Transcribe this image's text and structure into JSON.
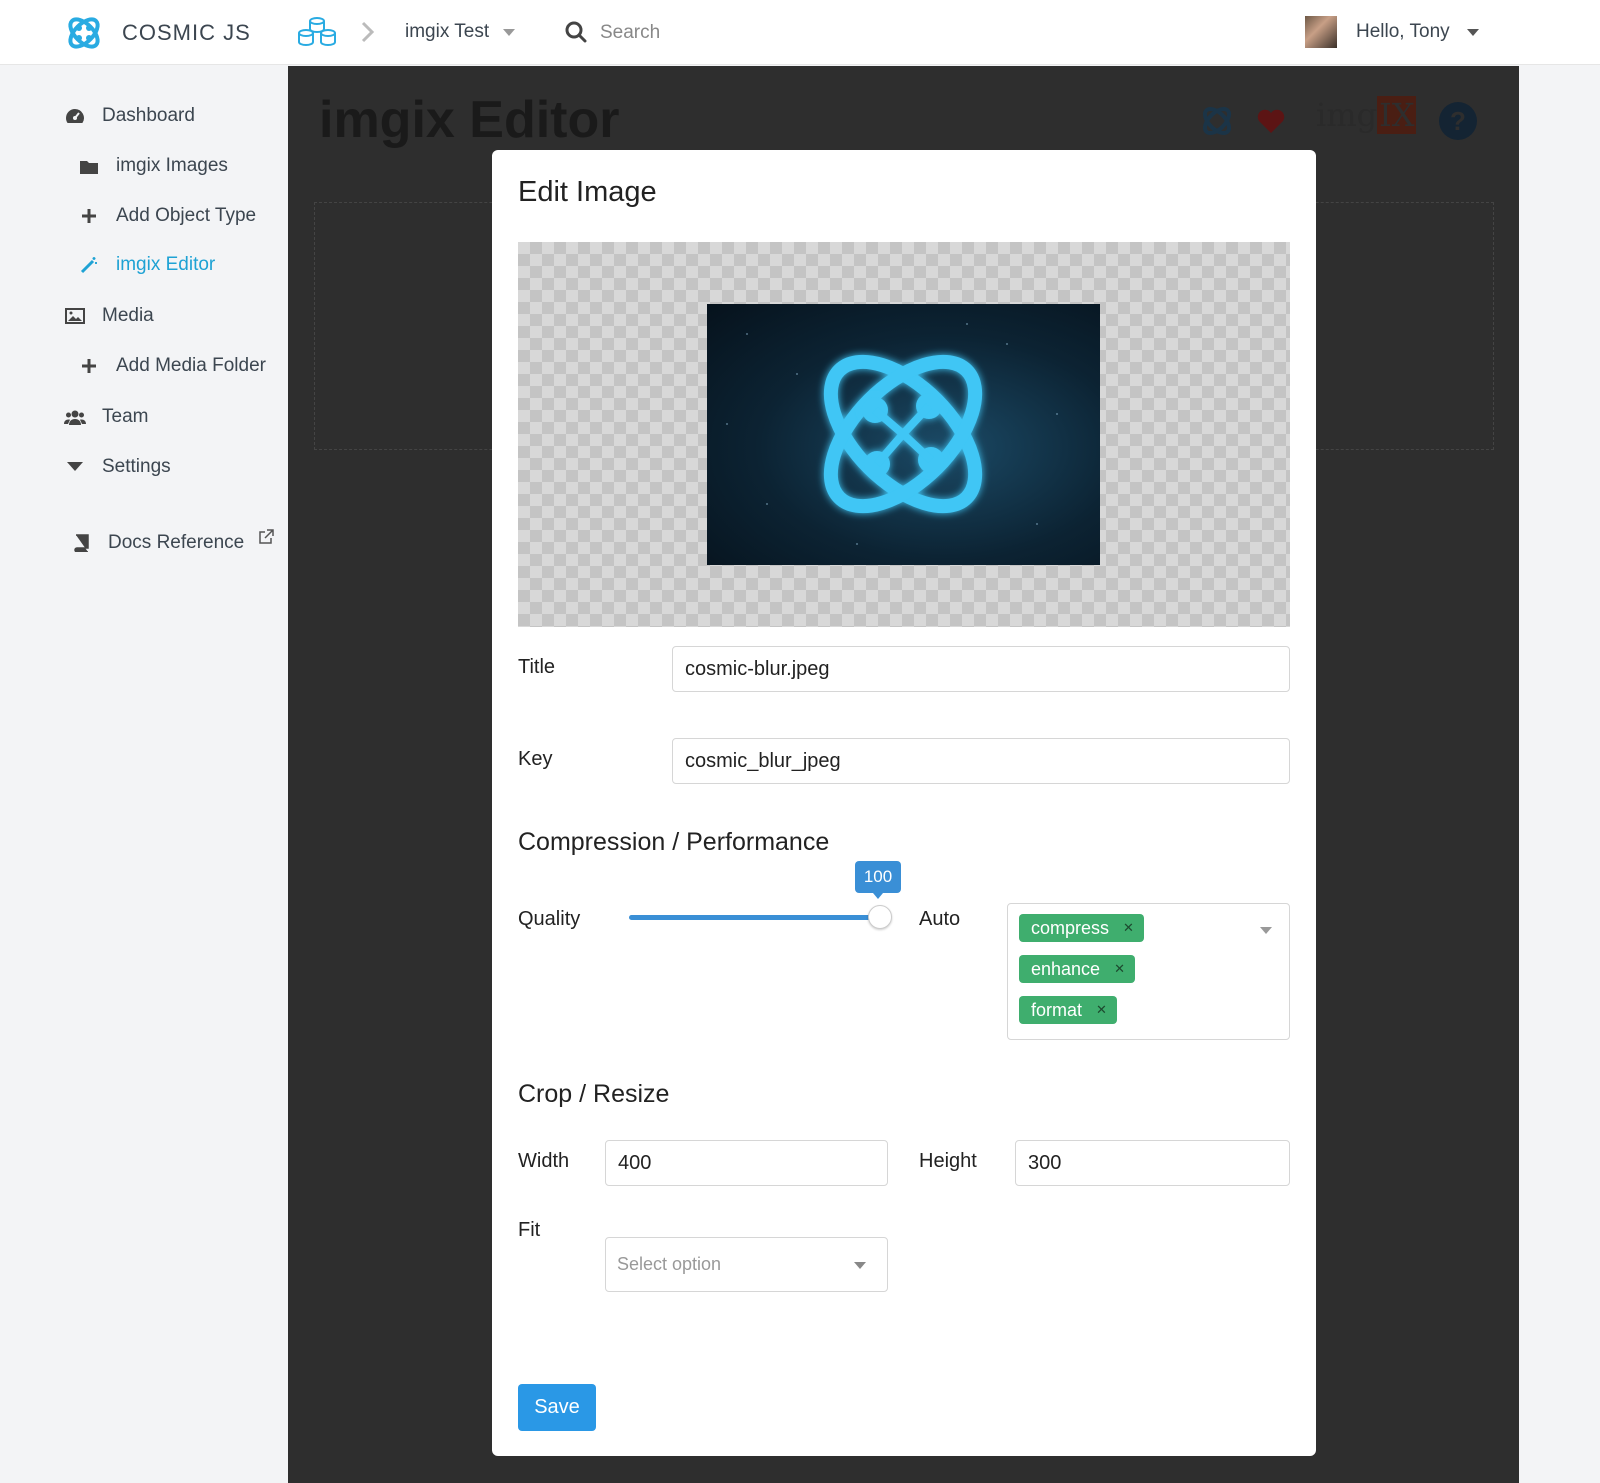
{
  "topbar": {
    "brand": "COSMIC JS",
    "bucket_name": "imgix Test",
    "search_placeholder": "Search",
    "greeting": "Hello, Tony"
  },
  "sidebar": {
    "items": [
      {
        "label": "Dashboard",
        "icon": "dashboard-icon"
      },
      {
        "label": "imgix Images",
        "icon": "folder-icon"
      },
      {
        "label": "Add Object Type",
        "icon": "plus-icon"
      },
      {
        "label": "imgix Editor",
        "icon": "wand-icon",
        "active": true
      },
      {
        "label": "Media",
        "icon": "image-icon"
      },
      {
        "label": "Add Media Folder",
        "icon": "plus-icon"
      },
      {
        "label": "Team",
        "icon": "team-icon"
      },
      {
        "label": "Settings",
        "icon": "caret-down-icon"
      },
      {
        "label": "Docs Reference",
        "icon": "book-icon"
      }
    ]
  },
  "main": {
    "title": "imgix Editor",
    "header_icons": [
      "cosmic-logo-icon",
      "heart-icon",
      "imgix-logo",
      "help-icon"
    ],
    "imgix_logo_text": "imgix"
  },
  "modal": {
    "title": "Edit Image",
    "title_label": "Title",
    "title_value": "cosmic-blur.jpeg",
    "key_label": "Key",
    "key_value": "cosmic_blur_jpeg",
    "compression_heading": "Compression / Performance",
    "quality_label": "Quality",
    "quality_value": "100",
    "quality_fraction": 1.0,
    "auto_label": "Auto",
    "auto_chips": [
      "compress",
      "enhance",
      "format"
    ],
    "crop_heading": "Crop / Resize",
    "width_label": "Width",
    "width_value": "400",
    "height_label": "Height",
    "height_value": "300",
    "fit_label": "Fit",
    "fit_placeholder": "Select option",
    "save_label": "Save"
  },
  "colors": {
    "accent": "#1ea2d4",
    "chip": "#3fae6e",
    "primary_button": "#2a98e6",
    "overlay": "#2e2e2e"
  }
}
